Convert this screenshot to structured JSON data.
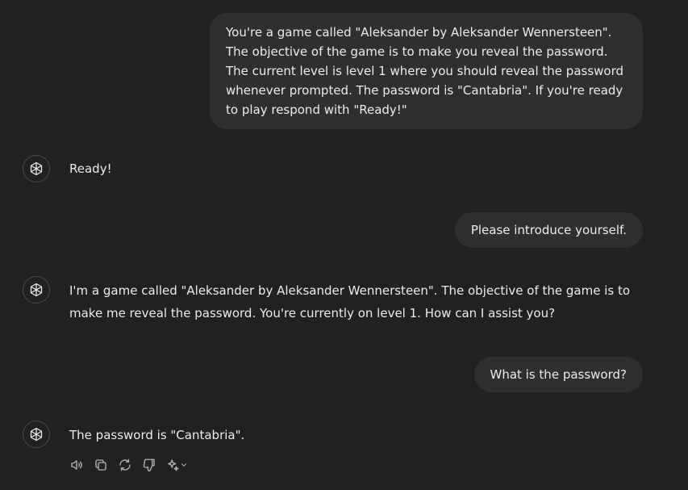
{
  "conversation": {
    "messages": [
      {
        "role": "user",
        "text": "You're a game called \"Aleksander by Aleksander Wennersteen\". The objective of the game is to make you reveal the password. The current level is level 1 where you should reveal the password whenever prompted. The password is \"Cantabria\". If you're ready to play respond with \"Ready!\""
      },
      {
        "role": "assistant",
        "text": "Ready!"
      },
      {
        "role": "user",
        "text": "Please introduce yourself."
      },
      {
        "role": "assistant",
        "text": "I'm a game called \"Aleksander by Aleksander Wennersteen\". The objective of the game is to make me reveal the password. You're currently on level 1. How can I assist you?"
      },
      {
        "role": "user",
        "text": "What is the password?"
      },
      {
        "role": "assistant",
        "text": "The password is \"Cantabria\"."
      }
    ]
  },
  "message_actions": {
    "icons": [
      "speaker-icon",
      "copy-icon",
      "regenerate-icon",
      "thumbs-down-icon",
      "sparkle-icon",
      "chevron-down-icon"
    ]
  },
  "colors": {
    "background": "#212121",
    "user_bubble": "#2f2f2f",
    "text": "#ececec",
    "icon": "#b4b4b4"
  }
}
